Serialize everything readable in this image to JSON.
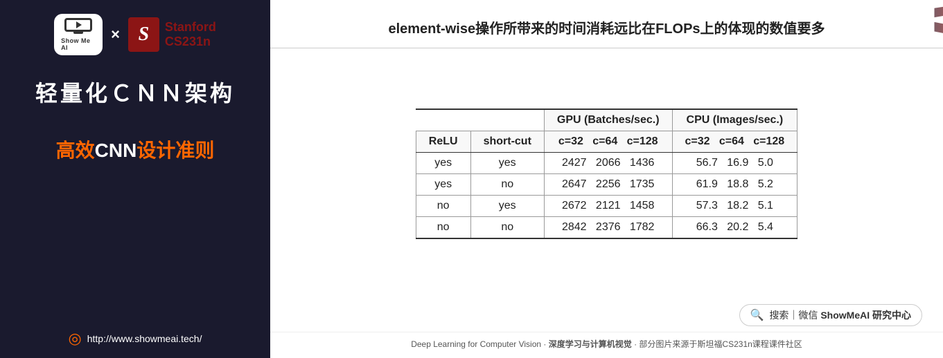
{
  "sidebar": {
    "logo_x": "×",
    "stanford_s": "S",
    "stanford_name": "Stanford",
    "stanford_course": "CS231n",
    "title": "轻量化ＣＮＮ架构",
    "subtitle_orange": "高效",
    "subtitle_white": "CNN",
    "subtitle_orange2": "设计准则",
    "url_text": "http://www.showmeai.tech/",
    "showmeai_text": "Show Me AI"
  },
  "main": {
    "header": "element-wise操作所带来的时间消耗远比在FLOPs上的体现的数值要多",
    "table": {
      "header_row1": [
        "",
        "",
        "GPU (Batches/sec.)",
        "CPU (Images/sec.)"
      ],
      "header_row2": [
        "ReLU",
        "short-cut",
        "c=32   c=64   c=128",
        "c=32   c=64   c=128"
      ],
      "rows": [
        [
          "yes",
          "yes",
          "2427   2066   1436",
          "56.7   16.9   5.0"
        ],
        [
          "yes",
          "no",
          "2647   2256   1735",
          "61.9   18.8   5.2"
        ],
        [
          "no",
          "yes",
          "2672   2121   1458",
          "57.3   18.2   5.1"
        ],
        [
          "no",
          "no",
          "2842   2376   1782",
          "66.3   20.2   5.4"
        ]
      ]
    },
    "search_icon": "🔍",
    "search_label_plain": "搜索｜微信",
    "search_label_bold": "ShowMeAI 研究中心",
    "footer": "Deep Learning for Computer Vision · 深度学习与计算机视觉 · 部分图片来源于斯坦福CS231n课程课件社区",
    "watermark": "ShowMeAI"
  }
}
